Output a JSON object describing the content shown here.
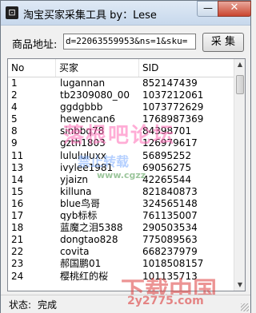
{
  "window": {
    "title": "淘宝买家采集工具  by：Lese",
    "icon_char": "⊡",
    "minimize_glyph": "—",
    "close_glyph": "✕"
  },
  "form": {
    "url_label": "商品地址:",
    "url_value": "d=22063559953&ns=1&sku=",
    "collect_button": "采 集"
  },
  "table": {
    "columns": [
      "No",
      "买家",
      "SID"
    ],
    "rows": [
      {
        "no": "1",
        "buyer": "lugannan",
        "sid": "852147439"
      },
      {
        "no": "2",
        "buyer": "tb2309080_00",
        "sid": "1037212061"
      },
      {
        "no": "4",
        "buyer": "ggdgbbb",
        "sid": "1073772629"
      },
      {
        "no": "5",
        "buyer": "hewencan6",
        "sid": "1768987369"
      },
      {
        "no": "8",
        "buyer": "sinbbq78",
        "sid": "84398701"
      },
      {
        "no": "9",
        "buyer": "gzth1803",
        "sid": "126979617"
      },
      {
        "no": "11",
        "buyer": "lulululuxx",
        "sid": "56895252"
      },
      {
        "no": "13",
        "buyer": "ivylee1981",
        "sid": "69056275"
      },
      {
        "no": "14",
        "buyer": "yjaizn",
        "sid": "42265544"
      },
      {
        "no": "15",
        "buyer": "killuna",
        "sid": "821840873"
      },
      {
        "no": "16",
        "buyer": "blue鸟哥",
        "sid": "324565148"
      },
      {
        "no": "17",
        "buyer": "qyb标标",
        "sid": "761135007"
      },
      {
        "no": "18",
        "buyer": "蓝魔之泪5388",
        "sid": "290503534"
      },
      {
        "no": "21",
        "buyer": "dongtao828",
        "sid": "775089563"
      },
      {
        "no": "22",
        "buyer": "covita",
        "sid": "668237979"
      },
      {
        "no": "23",
        "buyer": "郝国鹏01",
        "sid": "1018508157"
      },
      {
        "no": "24",
        "buyer": "樱桃红的桜",
        "sid": "101135713"
      }
    ]
  },
  "scrollbar": {
    "up_glyph": "▲",
    "down_glyph": "▼"
  },
  "status": {
    "label": "状态:",
    "value": "完成"
  },
  "watermarks": {
    "main": "落根吧论坛",
    "sub": "禁止转载",
    "domain_fragment": "www.cgzz",
    "bottom_large": "下载中国",
    "bottom_small": "2y2775.com"
  }
}
